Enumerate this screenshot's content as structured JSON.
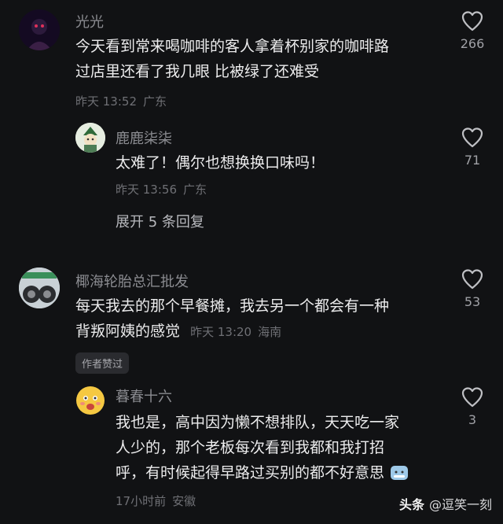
{
  "comments": [
    {
      "author": "光光",
      "text_lines": [
        "今天看到常来喝咖啡的客人拿着杯别家的咖啡路",
        "过店里还看了我几眼 比被绿了还难受"
      ],
      "time": "昨天 13:52",
      "location": "广东",
      "likes": "266",
      "reply": {
        "author": "鹿鹿柒柒",
        "text_lines": [
          "太难了！偶尔也想换换口味吗！"
        ],
        "time": "昨天 13:56",
        "location": "广东",
        "likes": "71"
      },
      "expand_label": "展开 5 条回复"
    },
    {
      "author": "椰海轮胎总汇批发",
      "text_lines": [
        "每天我去的那个早餐摊，我去另一个都会有一种",
        "背叛阿姨的感觉"
      ],
      "time": "昨天 13:20",
      "location": "海南",
      "likes": "53",
      "badge": "作者赞过",
      "reply": {
        "author": "暮春十六",
        "text_lines": [
          "我也是，高中因为懒不想排队，天天吃一家",
          "人少的，那个老板每次看到我都和我打招",
          "呼，有时候起得早路过买别的都不好意思"
        ],
        "time": "17小时前",
        "location": "安徽",
        "likes": "3"
      }
    }
  ],
  "watermark": {
    "logo": "头条",
    "handle": "@逗笑一刻"
  },
  "colors": {
    "background": "#111214",
    "text": "#ececed",
    "meta": "#6f7075"
  }
}
